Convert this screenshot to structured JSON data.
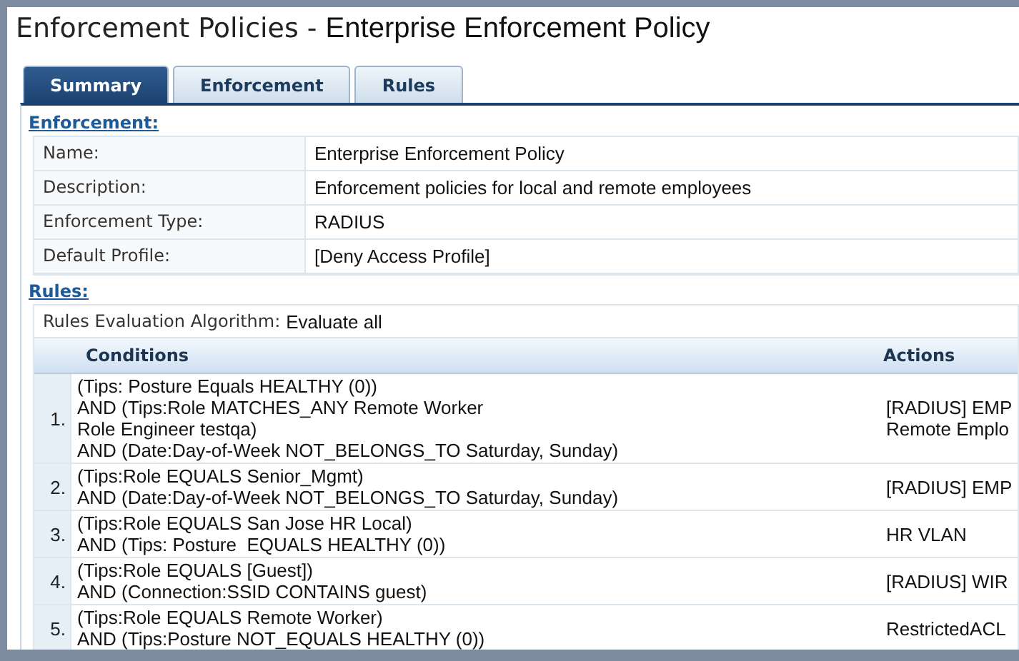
{
  "title": {
    "section": "Enforcement Policies -",
    "name": "Enterprise Enforcement Policy"
  },
  "tabs": [
    {
      "label": "Summary",
      "selected": true
    },
    {
      "label": "Enforcement",
      "selected": false
    },
    {
      "label": "Rules",
      "selected": false
    }
  ],
  "enforcement": {
    "heading": "Enforcement:",
    "fields": [
      {
        "label": "Name:",
        "value": "Enterprise Enforcement Policy"
      },
      {
        "label": "Description:",
        "value": "Enforcement policies for local and remote employees"
      },
      {
        "label": "Enforcement Type:",
        "value": "RADIUS"
      },
      {
        "label": "Default Profile:",
        "value": "[Deny Access Profile]"
      }
    ]
  },
  "rules": {
    "heading": "Rules:",
    "algorithm_label": "Rules Evaluation Algorithm:",
    "algorithm_value": "Evaluate all",
    "columns": [
      "Conditions",
      "Actions"
    ],
    "rows": [
      {
        "number": "1.",
        "conditions": [
          "(Tips: Posture Equals HEALTHY (0))",
          "AND (Tips:Role MATCHES_ANY Remote Worker",
          "Role Engineer testqa)",
          "AND (Date:Day-of-Week NOT_BELONGS_TO Saturday, Sunday)"
        ],
        "actions": [
          "[RADIUS] EMP",
          "Remote Emplo"
        ]
      },
      {
        "number": "2.",
        "conditions": [
          "(Tips:Role EQUALS Senior_Mgmt)",
          "AND (Date:Day-of-Week NOT_BELONGS_TO Saturday, Sunday)"
        ],
        "actions": [
          "[RADIUS] EMP"
        ]
      },
      {
        "number": "3.",
        "conditions": [
          "(Tips:Role EQUALS San Jose HR Local)",
          "AND (Tips: Posture  EQUALS HEALTHY (0))"
        ],
        "actions": [
          "HR VLAN"
        ]
      },
      {
        "number": "4.",
        "conditions": [
          "(Tips:Role EQUALS [Guest])",
          "AND (Connection:SSID CONTAINS guest)"
        ],
        "actions": [
          "[RADIUS] WIR"
        ]
      },
      {
        "number": "5.",
        "conditions": [
          "(Tips:Role EQUALS Remote Worker)",
          "AND (Tips:Posture NOT_EQUALS HEALTHY (0))"
        ],
        "actions": [
          "RestrictedACL"
        ]
      }
    ]
  }
}
